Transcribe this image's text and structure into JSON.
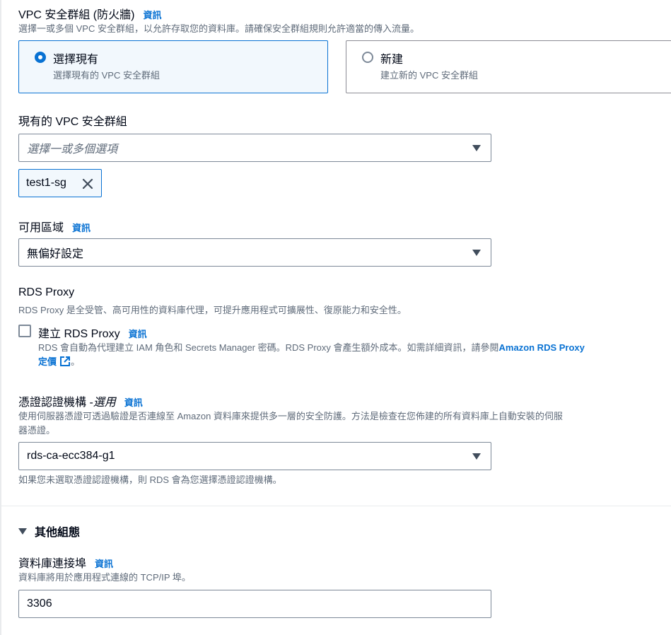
{
  "vpc_security_group": {
    "title": "VPC 安全群組 (防火牆)",
    "info": "資訊",
    "description": "選擇一或多個 VPC 安全群組，以允許存取您的資料庫。請確保安全群組規則允許適當的傳入流量。",
    "options": [
      {
        "title": "選擇現有",
        "description": "選擇現有的 VPC 安全群組",
        "selected": true
      },
      {
        "title": "新建",
        "description": "建立新的 VPC 安全群組",
        "selected": false
      }
    ]
  },
  "existing_sg": {
    "label": "現有的 VPC 安全群組",
    "placeholder": "選擇一或多個選項",
    "tokens": [
      "test1-sg"
    ]
  },
  "availability_zone": {
    "label": "可用區域",
    "info": "資訊",
    "value": "無偏好設定"
  },
  "rds_proxy": {
    "title": "RDS Proxy",
    "description": "RDS Proxy 是全受管、高可用性的資料庫代理，可提升應用程式可擴展性、復原能力和安全性。",
    "checkbox_label": "建立 RDS Proxy",
    "info": "資訊",
    "checked": false,
    "help_text": "RDS 會自動為代理建立 IAM 角色和 Secrets Manager 密碼。RDS Proxy 會產生額外成本。如需詳細資訊，請參閱",
    "link_text_line1": "Amazon RDS Proxy",
    "link_text_line2": "定價",
    "help_suffix": "。"
  },
  "certificate_authority": {
    "label": "憑證認證機構 - ",
    "label_optional": "選用",
    "info": "資訊",
    "description_line1": "使用伺服器憑證可透過驗證是否連線至 Amazon 資料庫來提供多一層的安全防護。方法是檢查在您佈建的所有資料庫上自動安裝的伺服",
    "description_line2": "器憑證。",
    "value": "rds-ca-ecc384-g1",
    "hint": "如果您未選取憑證認證機構，則 RDS 會為您選擇憑證認證機構。"
  },
  "additional_config": {
    "title": "其他組態"
  },
  "db_port": {
    "label": "資料庫連接埠",
    "info": "資訊",
    "description": "資料庫將用於應用程式連線的 TCP/IP 埠。",
    "value": "3306"
  },
  "colors": {
    "accent": "#0972d3",
    "text": "#000716",
    "muted": "#5f6b7a",
    "border": "#7d8998"
  }
}
